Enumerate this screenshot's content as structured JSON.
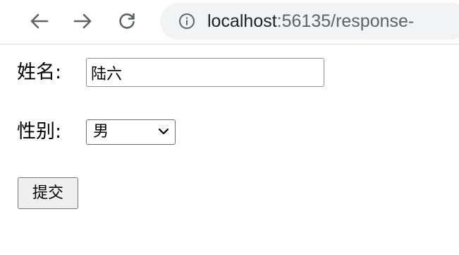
{
  "browser": {
    "url_host": "localhost",
    "url_rest": ":56135/response-",
    "icons": {
      "back": "arrow-left-icon",
      "forward": "arrow-right-icon",
      "reload": "reload-icon",
      "info": "info-icon"
    }
  },
  "form": {
    "name_label": "姓名:",
    "name_value": "陆六",
    "gender_label": "性别:",
    "gender_selected": "男",
    "submit_label": "提交"
  }
}
